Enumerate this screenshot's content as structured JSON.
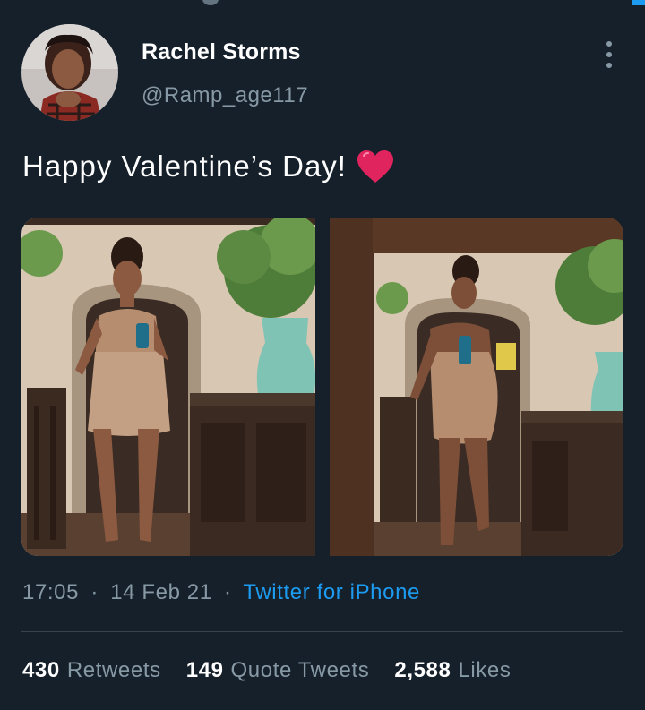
{
  "author": {
    "name": "Rachel Storms",
    "handle": "@Ramp_age117"
  },
  "tweet": {
    "text": "Happy Valentine’s Day!",
    "emoji": "heart-icon"
  },
  "media": [
    {
      "alt": "Mirror selfie, front view"
    },
    {
      "alt": "Mirror selfie, side view"
    }
  ],
  "meta": {
    "time": "17:05",
    "sep1": "·",
    "date": "14 Feb 21",
    "sep2": "·",
    "source": "Twitter for iPhone"
  },
  "stats": {
    "retweets_count": "430",
    "retweets_label": "Retweets",
    "quotes_count": "149",
    "quotes_label": "Quote Tweets",
    "likes_count": "2,588",
    "likes_label": "Likes"
  },
  "colors": {
    "background": "#15202b",
    "muted": "#8899a6",
    "accent": "#1d9bf0",
    "heart": "#e0245e"
  }
}
